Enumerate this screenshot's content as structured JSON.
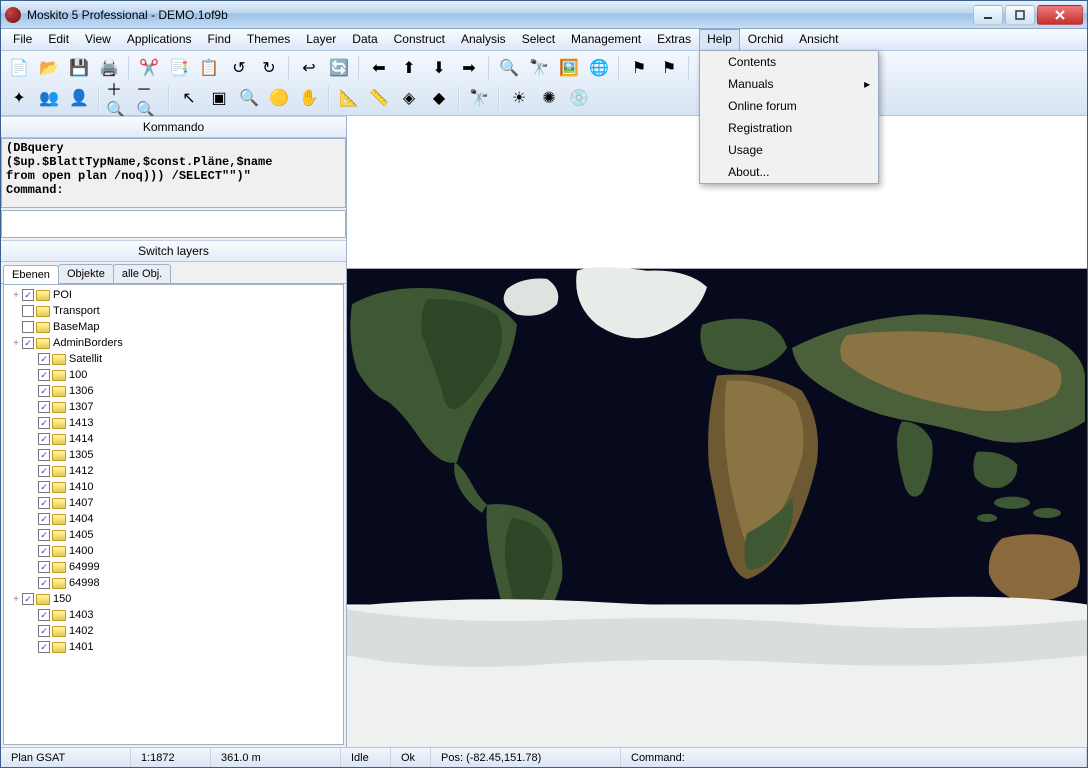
{
  "window": {
    "title": "Moskito 5 Professional - DEMO.1of9b"
  },
  "menu": {
    "items": [
      "File",
      "Edit",
      "View",
      "Applications",
      "Find",
      "Themes",
      "Layer",
      "Data",
      "Construct",
      "Analysis",
      "Select",
      "Management",
      "Extras",
      "Help",
      "Orchid",
      "Ansicht"
    ],
    "open_index": 13,
    "help_dropdown": [
      {
        "label": "Contents",
        "sub": false
      },
      {
        "label": "Manuals",
        "sub": true
      },
      {
        "label": "Online forum",
        "sub": false
      },
      {
        "label": "Registration",
        "sub": false
      },
      {
        "label": "Usage",
        "sub": false
      },
      {
        "label": "About...",
        "sub": false
      }
    ]
  },
  "toolbar": {
    "row1": [
      {
        "name": "new",
        "glyph": "📄"
      },
      {
        "name": "open",
        "glyph": "📂"
      },
      {
        "name": "save",
        "glyph": "💾"
      },
      {
        "name": "print",
        "glyph": "🖨️"
      },
      {
        "sep": true
      },
      {
        "name": "cut",
        "glyph": "✂️"
      },
      {
        "name": "copy",
        "glyph": "📑"
      },
      {
        "name": "paste",
        "glyph": "📋"
      },
      {
        "name": "undo",
        "glyph": "↺"
      },
      {
        "name": "redo",
        "glyph": "↻"
      },
      {
        "sep": true
      },
      {
        "name": "back",
        "glyph": "↩"
      },
      {
        "name": "sync",
        "glyph": "🔄"
      },
      {
        "sep": true
      },
      {
        "name": "arrow-left",
        "glyph": "⬅"
      },
      {
        "name": "arrow-up",
        "glyph": "⬆"
      },
      {
        "name": "arrow-down",
        "glyph": "⬇"
      },
      {
        "name": "arrow-right",
        "glyph": "➡"
      },
      {
        "sep": true
      },
      {
        "name": "zoom",
        "glyph": "🔍"
      },
      {
        "name": "zoom-extent",
        "glyph": "🔭"
      },
      {
        "name": "image",
        "glyph": "🖼️"
      },
      {
        "name": "globe",
        "glyph": "🌐"
      },
      {
        "sep": true
      },
      {
        "name": "flag-a",
        "glyph": "⚑"
      },
      {
        "name": "flag-b",
        "glyph": "⚑"
      },
      {
        "sep": true
      },
      {
        "name": "flag1",
        "glyph": "▛"
      },
      {
        "name": "flag2",
        "glyph": "▜"
      },
      {
        "name": "flag3",
        "glyph": "▟"
      },
      {
        "sep": true
      },
      {
        "name": "window",
        "glyph": "▭"
      },
      {
        "name": "delete",
        "glyph": "✖"
      },
      {
        "name": "exit",
        "glyph": "🏃"
      }
    ],
    "row2": [
      {
        "name": "nodes",
        "glyph": "✦"
      },
      {
        "name": "users",
        "glyph": "👥"
      },
      {
        "name": "group",
        "glyph": "👤"
      },
      {
        "sep": true
      },
      {
        "name": "zoom-in",
        "glyph": "＋🔍"
      },
      {
        "name": "zoom-out",
        "glyph": "－🔍"
      },
      {
        "sep": true
      },
      {
        "name": "pointer",
        "glyph": "↖"
      },
      {
        "name": "select-rect",
        "glyph": "▣"
      },
      {
        "name": "inspect",
        "glyph": "🔍"
      },
      {
        "name": "highlight",
        "glyph": "🟡"
      },
      {
        "name": "pan",
        "glyph": "✋"
      },
      {
        "sep": true
      },
      {
        "name": "measure-poly",
        "glyph": "📐"
      },
      {
        "name": "measure-line",
        "glyph": "📏"
      },
      {
        "name": "cube-a",
        "glyph": "◈"
      },
      {
        "name": "cube-b",
        "glyph": "◆"
      },
      {
        "sep": true
      },
      {
        "name": "binoc",
        "glyph": "🔭"
      },
      {
        "sep": true
      },
      {
        "name": "sun-a",
        "glyph": "☀"
      },
      {
        "name": "sun-b",
        "glyph": "✺"
      },
      {
        "name": "disc",
        "glyph": "💿"
      }
    ]
  },
  "panels": {
    "kommando_title": "Kommando",
    "cmd_text": "(DBquery\n($up.$BlattTypName,$const.Pläne,$name\nfrom open plan /noq))) /SELECT\"\")\"\nCommand:",
    "switch_title": "Switch layers",
    "tabs": [
      "Ebenen",
      "Objekte",
      "alle Obj."
    ],
    "active_tab": 0
  },
  "tree": [
    {
      "indent": 0,
      "tw": "+",
      "chk": true,
      "label": "POI"
    },
    {
      "indent": 0,
      "tw": "",
      "chk": false,
      "label": "Transport"
    },
    {
      "indent": 0,
      "tw": "",
      "chk": false,
      "label": "BaseMap"
    },
    {
      "indent": 0,
      "tw": "+",
      "chk": true,
      "label": "AdminBorders"
    },
    {
      "indent": 1,
      "tw": "",
      "chk": true,
      "label": "Satellit"
    },
    {
      "indent": 1,
      "tw": "",
      "chk": true,
      "label": "100"
    },
    {
      "indent": 1,
      "tw": "",
      "chk": true,
      "label": "1306"
    },
    {
      "indent": 1,
      "tw": "",
      "chk": true,
      "label": "1307"
    },
    {
      "indent": 1,
      "tw": "",
      "chk": true,
      "label": "1413"
    },
    {
      "indent": 1,
      "tw": "",
      "chk": true,
      "label": "1414"
    },
    {
      "indent": 1,
      "tw": "",
      "chk": true,
      "label": "1305"
    },
    {
      "indent": 1,
      "tw": "",
      "chk": true,
      "label": "1412"
    },
    {
      "indent": 1,
      "tw": "",
      "chk": true,
      "label": "1410"
    },
    {
      "indent": 1,
      "tw": "",
      "chk": true,
      "label": "1407"
    },
    {
      "indent": 1,
      "tw": "",
      "chk": true,
      "label": "1404"
    },
    {
      "indent": 1,
      "tw": "",
      "chk": true,
      "label": "1405"
    },
    {
      "indent": 1,
      "tw": "",
      "chk": true,
      "label": "1400"
    },
    {
      "indent": 1,
      "tw": "",
      "chk": true,
      "label": "64999"
    },
    {
      "indent": 1,
      "tw": "",
      "chk": true,
      "label": "64998"
    },
    {
      "indent": 0,
      "tw": "+",
      "chk": true,
      "label": "150"
    },
    {
      "indent": 1,
      "tw": "",
      "chk": true,
      "label": "1403"
    },
    {
      "indent": 1,
      "tw": "",
      "chk": true,
      "label": "1402"
    },
    {
      "indent": 1,
      "tw": "",
      "chk": true,
      "label": "1401"
    }
  ],
  "status": {
    "plan": "Plan GSAT",
    "scale": "1:1872",
    "dist": "361.0 m",
    "state": "Idle",
    "ok": "Ok",
    "pos": "Pos: (-82.45,151.78)",
    "cmd": "Command:"
  }
}
